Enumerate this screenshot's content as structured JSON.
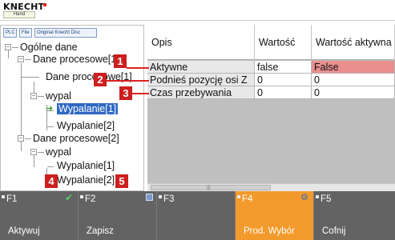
{
  "app": {
    "logo_text": "KNECHT",
    "logo_sub": "Hand"
  },
  "tabs": [
    {
      "label": "PLC"
    },
    {
      "label": "File"
    },
    {
      "label": "Original Knecht Disc"
    }
  ],
  "tree": {
    "root": "Ogólne dane",
    "nodes": [
      "Dane procesowe[1]",
      "Dane procesowe[1]",
      "wypal",
      "Wypalanie[1]",
      "Wypalanie[2]",
      "Dane procesowe[2]",
      "wypal",
      "Wypalanie[1]",
      "Wypalanie[2]"
    ],
    "selected": "Wypalanie[1]"
  },
  "grid": {
    "headers": [
      "Opis",
      "Wartość",
      "Wartość aktywna"
    ],
    "rows": [
      {
        "opis": "Aktywne",
        "wartosc": "false",
        "aktywna": "False"
      },
      {
        "opis": "Podnieś pozycję osi Z",
        "wartosc": "0",
        "aktywna": "0"
      },
      {
        "opis": "Czas przebywania",
        "wartosc": "0",
        "aktywna": "0"
      }
    ]
  },
  "markers": [
    "1",
    "2",
    "3",
    "4",
    "5"
  ],
  "fkeys": [
    {
      "key": "F1",
      "label": "Aktywuj",
      "badge": "check-icon"
    },
    {
      "key": "F2",
      "label": "Zapisz",
      "badge": "disk-icon"
    },
    {
      "key": "F3",
      "label": "",
      "badge": ""
    },
    {
      "key": "F4",
      "label": "Prod. Wybór",
      "badge": "gear-icon"
    },
    {
      "key": "F5",
      "label": "Cofnij",
      "badge": ""
    }
  ],
  "colors": {
    "accent_orange": "#f39a2c",
    "marker_red": "#cd1f1f",
    "selection_blue": "#2f68c3",
    "active_false_red": "#e98f8f",
    "fkey_bar": "#636363"
  }
}
